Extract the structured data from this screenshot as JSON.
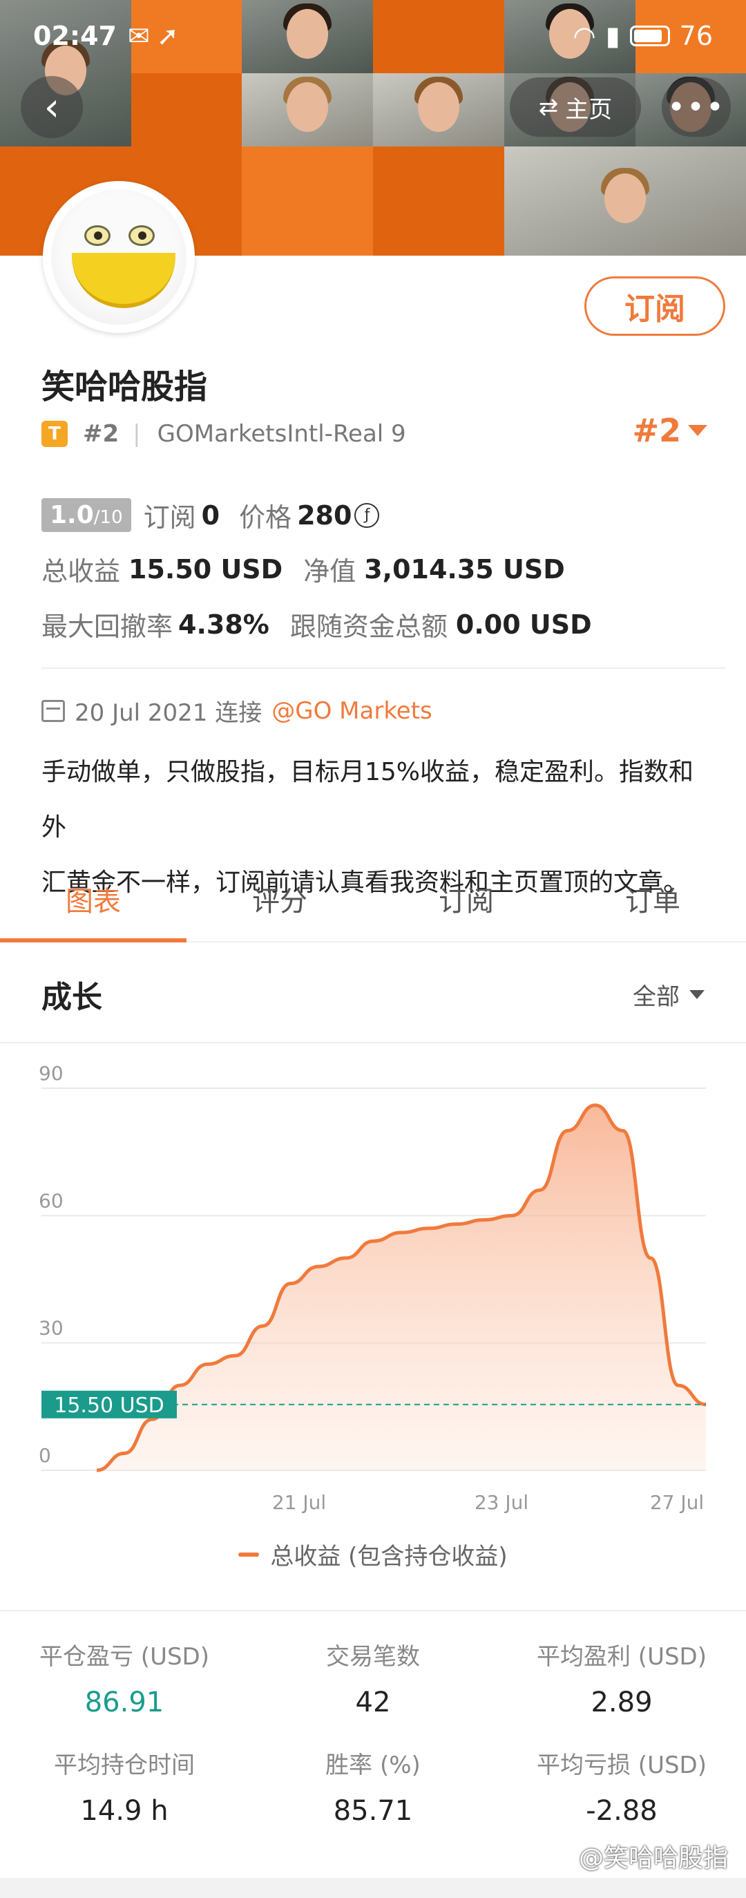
{
  "status_bar": {
    "time": "02:47",
    "battery": "76",
    "icons": [
      "mail-icon",
      "send-icon",
      "wifi-icon",
      "signal-icon",
      "battery-icon"
    ]
  },
  "nav": {
    "home_label": "主页",
    "more_label": "•••",
    "back_label": "‹"
  },
  "profile": {
    "subscribe_label": "订阅",
    "name": "笑哈哈股指",
    "badge": "T",
    "rank": "#2",
    "separator": "|",
    "account": "GOMarketsIntl-Real 9",
    "rank_big": "#2"
  },
  "stats": {
    "score": "1.0",
    "score_max": "/10",
    "subscribe_label": "订阅",
    "subscribe_count": "0",
    "price_label": "价格",
    "price_value": "280",
    "coin_symbol": "ƒ",
    "total_profit_label": "总收益",
    "total_profit_value": "15.50 USD",
    "equity_label": "净值",
    "equity_value": "3,014.35 USD",
    "max_drawdown_label": "最大回撤率",
    "max_drawdown_value": "4.38%",
    "follow_funds_label": "跟随资金总额",
    "follow_funds_value": "0.00 USD"
  },
  "join": {
    "date": "20 Jul 2021 连接",
    "broker": "@GO Markets"
  },
  "description_line1": "手动做单，只做股指，目标月15%收益，稳定盈利。指数和外",
  "description_line2": "汇黄金不一样，订阅前请认真看我资料和主页置顶的文章。",
  "tabs": [
    "图表",
    "评分",
    "订阅",
    "订单"
  ],
  "section": {
    "title": "成长",
    "filter_label": "全部"
  },
  "chart_data": {
    "type": "area",
    "x_ticks": [
      "21 Jul",
      "23 Jul",
      "27 Jul"
    ],
    "y_ticks": [
      "90",
      "60",
      "30",
      "0"
    ],
    "ylim": [
      0,
      90
    ],
    "grid": true,
    "series": [
      {
        "name": "总收益 (包含持仓收益)",
        "values": [
          0,
          4,
          12,
          20,
          25,
          27,
          34,
          44,
          48,
          50,
          54,
          56,
          57,
          58,
          59,
          60,
          66,
          80,
          86,
          80,
          50,
          20,
          15.5
        ]
      }
    ],
    "reference_line": {
      "value": 15.5,
      "label": "15.50 USD"
    },
    "legend_position": "bottom",
    "color": "#f07a3c"
  },
  "summary": [
    {
      "label": "平仓盈亏 (USD)",
      "value": "86.91",
      "green": true
    },
    {
      "label": "交易笔数",
      "value": "42",
      "green": false
    },
    {
      "label": "平均盈利 (USD)",
      "value": "2.89",
      "green": false
    },
    {
      "label": "平均持仓时间",
      "value": "14.9 h",
      "green": false
    },
    {
      "label": "胜率 (%)",
      "value": "85.71",
      "green": false
    },
    {
      "label": "平均亏损 (USD)",
      "value": "-2.88",
      "green": false
    }
  ],
  "watermark": "@笑哈哈股指"
}
